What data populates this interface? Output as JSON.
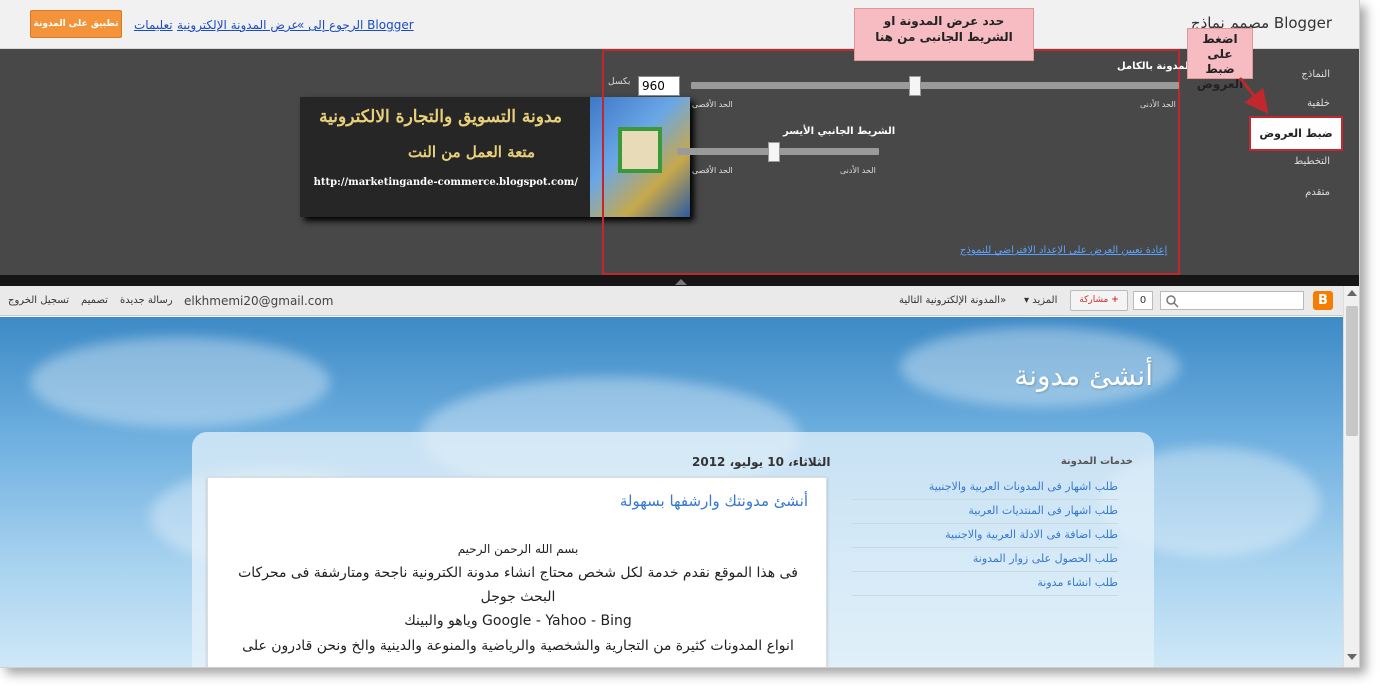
{
  "topbar": {
    "apply_label": "تطبيق على المدونة",
    "help_link": "تعليمات",
    "view_blog_link": "عرض المدونة الإلكترونية",
    "back_link": "« الرجوع إلى Blogger",
    "designer_title": "مصمم نماذج Blogger"
  },
  "nav": {
    "items": [
      "النماذج",
      "خلفية",
      "ضبط العروض",
      "التخطيط",
      "متقدم"
    ],
    "active_index": 2
  },
  "callouts": {
    "set_width": "حدد عرض المدونة او الشريط الجانبى من هنا",
    "click_widths": "اضغط على ضبط العروض"
  },
  "width_panel": {
    "entire_blog_label": "المدونة بالكامل",
    "px_value": "960",
    "px_unit": "بكسل",
    "min_label": "الحد الأدنى",
    "max_label": "الحد الأقصى",
    "entire_blog_fraction": 0.54,
    "left_sidebar_label": "الشريط الجانبي الأيسر",
    "left_sidebar_fraction": 0.52,
    "reset_link": "إعادة تعيين العرض على الإعداد الافتراضي للنموذج"
  },
  "banner": {
    "line1": "مدونة التسويق والتجارة الالكترونية",
    "line2": "متعة العمل من النت",
    "url": "http://marketingande-commerce.blogspot.com/"
  },
  "navbar": {
    "share_count": "0",
    "share_label": "مشاركة",
    "more_label": "المزيد",
    "next_blog": "المدونة الإلكترونية التالية»",
    "email": "elkhmemi20@gmail.com",
    "new_post": "رسالة جديدة",
    "design": "تصميم",
    "sign_out": "تسجيل الخروج"
  },
  "blog": {
    "title": "أنشئ مدونة",
    "post_date": "الثلاثاء، 10 يوليو، 2012",
    "post_title": "أنشئ مدونتك وارشفها بسهولة",
    "post_lines": [
      "بسم الله الرحمن الرحيم",
      "فى هذا الموقع نقدم خدمة لكل شخص محتاج انشاء مدونة الكترونية ناجحة ومتارشفة فى محركات",
      "البحث جوجل",
      "وياهو والبينك Google - Yahoo - Bing",
      "انواع المدونات كثيرة من التجارية والشخصية والرياضية والمنوعة والدينية والخ ونحن قادرون على"
    ],
    "sidebar_title": "خدمات المدونة",
    "sidebar_items": [
      "طلب اشهار فى المدونات العربية والاجنبية",
      "طلب اشهار فى المنتديات العربية",
      "طلب اضافة فى الادلة العربية والاجنبية",
      "طلب الحصول على زوار المدونة",
      "طلب انشاء مدونة"
    ]
  },
  "colors": {
    "accent_orange": "#f3943a",
    "highlight_red": "#c1272d",
    "callout_pink": "#f6bcc2",
    "link_blue": "#3778cd"
  }
}
